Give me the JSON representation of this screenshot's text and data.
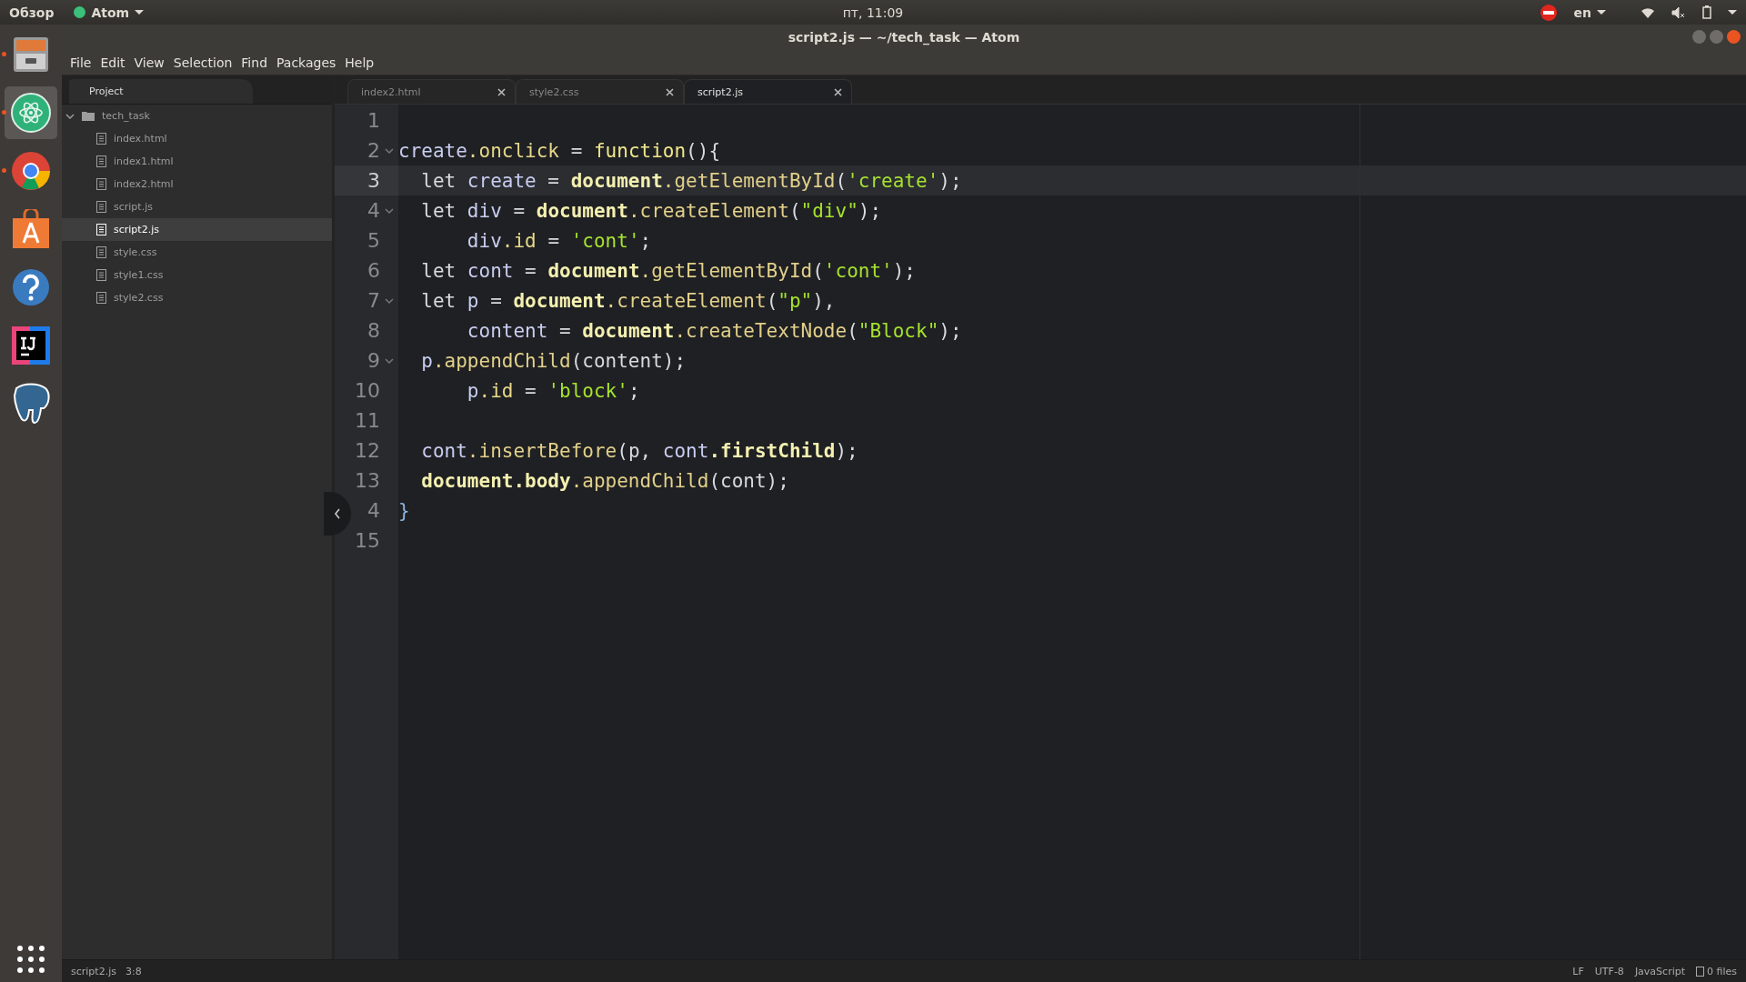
{
  "top_bar": {
    "activities": "Обзор",
    "app_menu": "Atom",
    "clock": "пт, 11:09",
    "keyboard": "en"
  },
  "dock": [
    {
      "kind": "files",
      "running": true,
      "selected": false
    },
    {
      "kind": "atom",
      "running": true,
      "selected": true
    },
    {
      "kind": "browser",
      "running": true,
      "selected": false
    },
    {
      "kind": "store",
      "running": false,
      "selected": false
    },
    {
      "kind": "help",
      "running": false,
      "selected": false
    },
    {
      "kind": "ide",
      "running": false,
      "selected": false
    },
    {
      "kind": "database",
      "running": false,
      "selected": false
    }
  ],
  "window": {
    "title": "script2.js — ~/tech_task — Atom"
  },
  "menu": [
    "File",
    "Edit",
    "View",
    "Selection",
    "Find",
    "Packages",
    "Help"
  ],
  "tree_panel": {
    "tab": "Project",
    "root": {
      "label": "tech_task",
      "expanded": true,
      "children": [
        {
          "label": "index.html",
          "selected": false
        },
        {
          "label": "index1.html",
          "selected": false
        },
        {
          "label": "index2.html",
          "selected": false
        },
        {
          "label": "script.js",
          "selected": false
        },
        {
          "label": "script2.js",
          "selected": true
        },
        {
          "label": "style.css",
          "selected": false
        },
        {
          "label": "style1.css",
          "selected": false
        },
        {
          "label": "style2.css",
          "selected": false
        }
      ]
    }
  },
  "tabs": [
    {
      "label": "index2.html",
      "selected": false
    },
    {
      "label": "style2.css",
      "selected": false
    },
    {
      "label": "script2.js",
      "selected": true
    }
  ],
  "editor": {
    "lines": [
      {
        "number": "1",
        "fold": false,
        "cursor": false
      },
      {
        "number": "2",
        "fold": true,
        "cursor": false,
        "tokens": [
          {
            "kind": "var",
            "text": "create"
          },
          {
            "kind": "prop",
            "text": ".onclick"
          },
          {
            "kind": "plain",
            "text": " = "
          },
          {
            "kind": "func",
            "text": "function"
          },
          {
            "kind": "plain",
            "text": "(){"
          }
        ]
      },
      {
        "number": "3",
        "fold": false,
        "cursor": true,
        "tokens": [
          {
            "kind": "plain",
            "text": "  let "
          },
          {
            "kind": "var",
            "text": "create"
          },
          {
            "kind": "plain",
            "text": " = "
          },
          {
            "kind": "obj",
            "text": "document"
          },
          {
            "kind": "method",
            "text": ".getElementById"
          },
          {
            "kind": "plain",
            "text": "("
          },
          {
            "kind": "string",
            "text": "'create'"
          },
          {
            "kind": "plain",
            "text": ");"
          }
        ]
      },
      {
        "number": "4",
        "fold": true,
        "cursor": false,
        "tokens": [
          {
            "kind": "plain",
            "text": "  let "
          },
          {
            "kind": "var",
            "text": "div"
          },
          {
            "kind": "plain",
            "text": " = "
          },
          {
            "kind": "obj",
            "text": "document"
          },
          {
            "kind": "method",
            "text": ".createElement"
          },
          {
            "kind": "plain",
            "text": "("
          },
          {
            "kind": "string",
            "text": "\"div\""
          },
          {
            "kind": "plain",
            "text": ");"
          }
        ]
      },
      {
        "number": "5",
        "fold": false,
        "cursor": false,
        "tokens": [
          {
            "kind": "var",
            "text": "      div"
          },
          {
            "kind": "prop",
            "text": ".id"
          },
          {
            "kind": "plain",
            "text": " = "
          },
          {
            "kind": "string",
            "text": "'cont'"
          },
          {
            "kind": "plain",
            "text": ";"
          }
        ]
      },
      {
        "number": "6",
        "fold": false,
        "cursor": false,
        "tokens": [
          {
            "kind": "plain",
            "text": "  let "
          },
          {
            "kind": "var",
            "text": "cont"
          },
          {
            "kind": "plain",
            "text": " = "
          },
          {
            "kind": "obj",
            "text": "document"
          },
          {
            "kind": "method",
            "text": ".getElementById"
          },
          {
            "kind": "plain",
            "text": "("
          },
          {
            "kind": "string",
            "text": "'cont'"
          },
          {
            "kind": "plain",
            "text": ");"
          }
        ]
      },
      {
        "number": "7",
        "fold": true,
        "cursor": false,
        "tokens": [
          {
            "kind": "plain",
            "text": "  let "
          },
          {
            "kind": "var",
            "text": "p"
          },
          {
            "kind": "plain",
            "text": " = "
          },
          {
            "kind": "obj",
            "text": "document"
          },
          {
            "kind": "method",
            "text": ".createElement"
          },
          {
            "kind": "plain",
            "text": "("
          },
          {
            "kind": "string",
            "text": "\"p\""
          },
          {
            "kind": "plain",
            "text": "),"
          }
        ]
      },
      {
        "number": "8",
        "fold": false,
        "cursor": false,
        "tokens": [
          {
            "kind": "var",
            "text": "      content"
          },
          {
            "kind": "plain",
            "text": " = "
          },
          {
            "kind": "obj",
            "text": "document"
          },
          {
            "kind": "method",
            "text": ".createTextNode"
          },
          {
            "kind": "plain",
            "text": "("
          },
          {
            "kind": "string",
            "text": "\"Block\""
          },
          {
            "kind": "plain",
            "text": ");"
          }
        ]
      },
      {
        "number": "9",
        "fold": true,
        "cursor": false,
        "tokens": [
          {
            "kind": "var",
            "text": "  p"
          },
          {
            "kind": "method",
            "text": ".appendChild"
          },
          {
            "kind": "plain",
            "text": "(content);"
          }
        ]
      },
      {
        "number": "10",
        "fold": false,
        "cursor": false,
        "tokens": [
          {
            "kind": "var",
            "text": "      p"
          },
          {
            "kind": "prop",
            "text": ".id"
          },
          {
            "kind": "plain",
            "text": " = "
          },
          {
            "kind": "string",
            "text": "'block'"
          },
          {
            "kind": "plain",
            "text": ";"
          }
        ]
      },
      {
        "number": "11",
        "fold": false,
        "cursor": false
      },
      {
        "number": "12",
        "fold": false,
        "cursor": false,
        "tokens": [
          {
            "kind": "var",
            "text": "  cont"
          },
          {
            "kind": "method",
            "text": ".insertBefore"
          },
          {
            "kind": "plain",
            "text": "(p, "
          },
          {
            "kind": "var",
            "text": "cont"
          },
          {
            "kind": "obj",
            "text": ".firstChild"
          },
          {
            "kind": "plain",
            "text": ");"
          }
        ]
      },
      {
        "number": "13",
        "fold": false,
        "cursor": false,
        "tokens": [
          {
            "kind": "obj",
            "text": "  document"
          },
          {
            "kind": "obj",
            "text": ".body"
          },
          {
            "kind": "method",
            "text": ".appendChild"
          },
          {
            "kind": "plain",
            "text": "(cont);"
          }
        ]
      },
      {
        "number": "4",
        "fold": false,
        "cursor": false,
        "tokens": [
          {
            "kind": "brace",
            "text": "}"
          }
        ]
      },
      {
        "number": "15",
        "fold": false,
        "cursor": false
      }
    ]
  },
  "status_bar": {
    "file": "script2.js",
    "position": "3:8",
    "line_ending": "LF",
    "encoding": "UTF-8",
    "grammar": "JavaScript",
    "files": "0 files"
  }
}
